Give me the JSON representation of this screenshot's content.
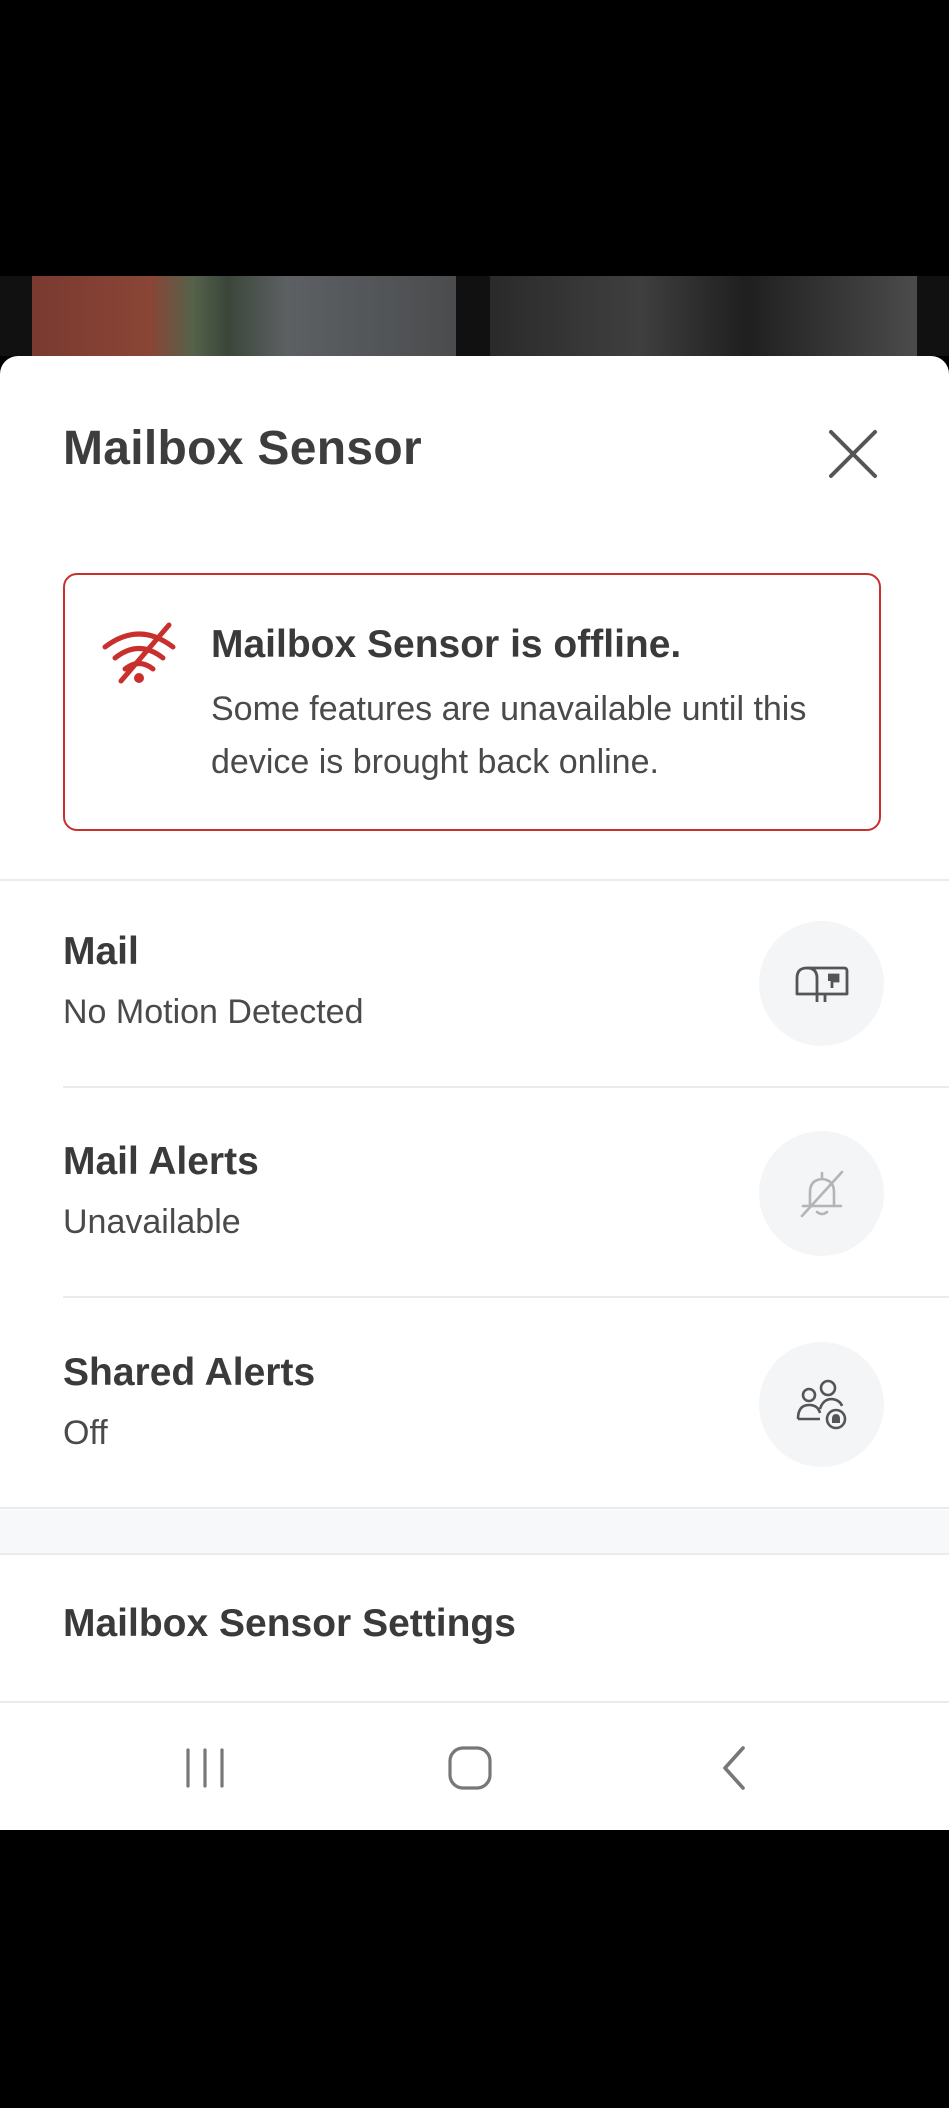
{
  "sheet": {
    "title": "Mailbox Sensor",
    "close_icon": "close-icon"
  },
  "alert": {
    "icon": "wifi-off-icon",
    "title": "Mailbox Sensor is offline.",
    "body": "Some features are unavailable until this device is brought back online.",
    "accent_color": "#c8302d"
  },
  "rows": [
    {
      "label": "Mail",
      "value": "No Motion Detected",
      "icon": "mailbox-icon"
    },
    {
      "label": "Mail Alerts",
      "value": "Unavailable",
      "icon": "bell-off-icon"
    },
    {
      "label": "Shared Alerts",
      "value": "Off",
      "icon": "shared-users-icon"
    }
  ],
  "settings": {
    "label": "Mailbox Sensor Settings"
  },
  "navbar": {
    "recent_icon": "recent-apps-icon",
    "home_icon": "home-icon",
    "back_icon": "back-icon"
  }
}
